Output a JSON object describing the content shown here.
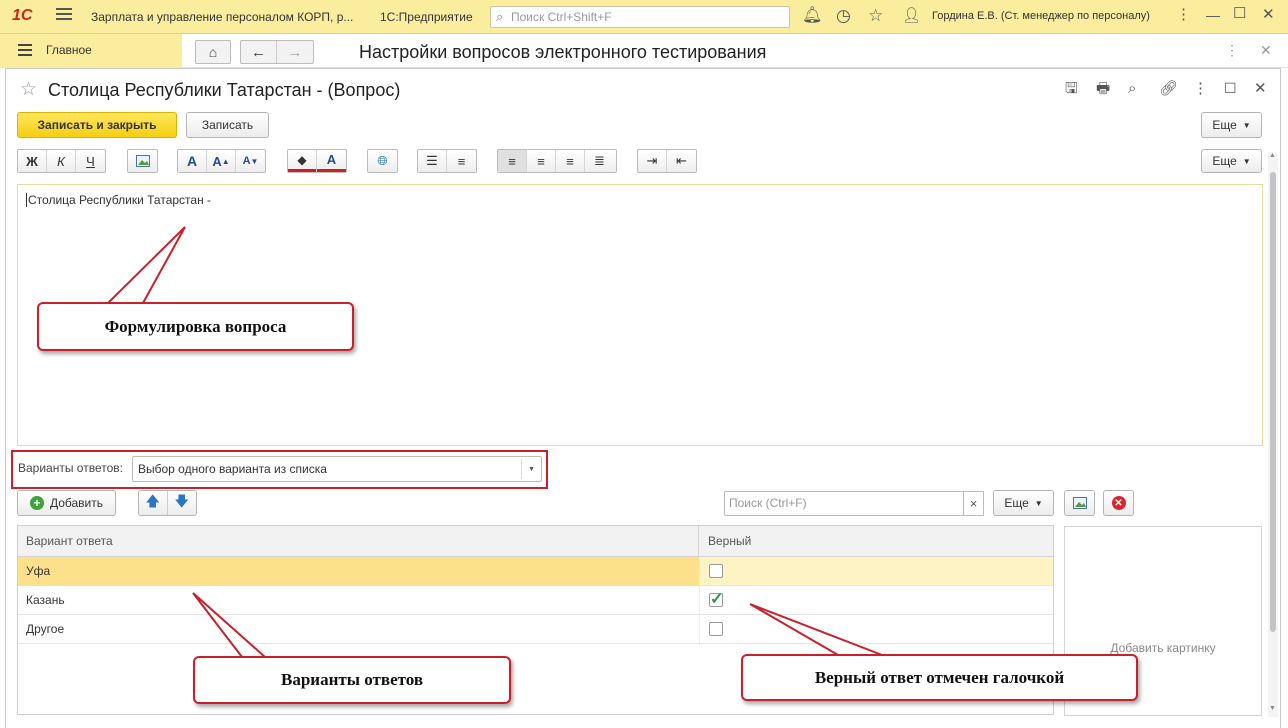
{
  "titlebar": {
    "logo": "1С",
    "app_title": "Зарплата и управление персоналом КОРП, р...",
    "app_name": "1С:Предприятие",
    "search_placeholder": "Поиск Ctrl+Shift+F",
    "user": "Гордина Е.В. (Ст. менеджер по персоналу)"
  },
  "sidebar": {
    "home_label": "Главное"
  },
  "header": {
    "page_title": "Настройки вопросов электронного тестирования"
  },
  "form": {
    "title": "Столица Республики Татарстан - (Вопрос)",
    "save_close_label": "Записать и закрыть",
    "save_label": "Записать",
    "more_label": "Еще",
    "more_label2": "Еще",
    "format_toolbar": {
      "bold": "Ж",
      "italic": "К",
      "underline": "Ч"
    },
    "question_text": "Столица Республики Татарстан -",
    "answers_label": "Варианты ответов:",
    "answers_mode": "Выбор одного варианта из списка",
    "add_label": "Добавить",
    "search_placeholder": "Поиск (Ctrl+F)",
    "search_clear": "×",
    "grid_more_label": "Еще",
    "columns": [
      "Вариант ответа",
      "Верный"
    ],
    "rows": [
      {
        "answer": "Уфа",
        "correct": false
      },
      {
        "answer": "Казань",
        "correct": true
      },
      {
        "answer": "Другое",
        "correct": false
      }
    ],
    "add_picture_label": "Добавить картинку"
  },
  "callouts": {
    "question": "Формулировка вопроса",
    "answers": "Варианты ответов",
    "correct": "Верный ответ отмечен галочкой"
  },
  "colors": {
    "accent_yellow": "#fbed9e",
    "button_yellow": "#f6cf11",
    "highlight_red": "#c9212b",
    "selected_row": "#fde08a",
    "check_green": "#2e9a3c"
  }
}
